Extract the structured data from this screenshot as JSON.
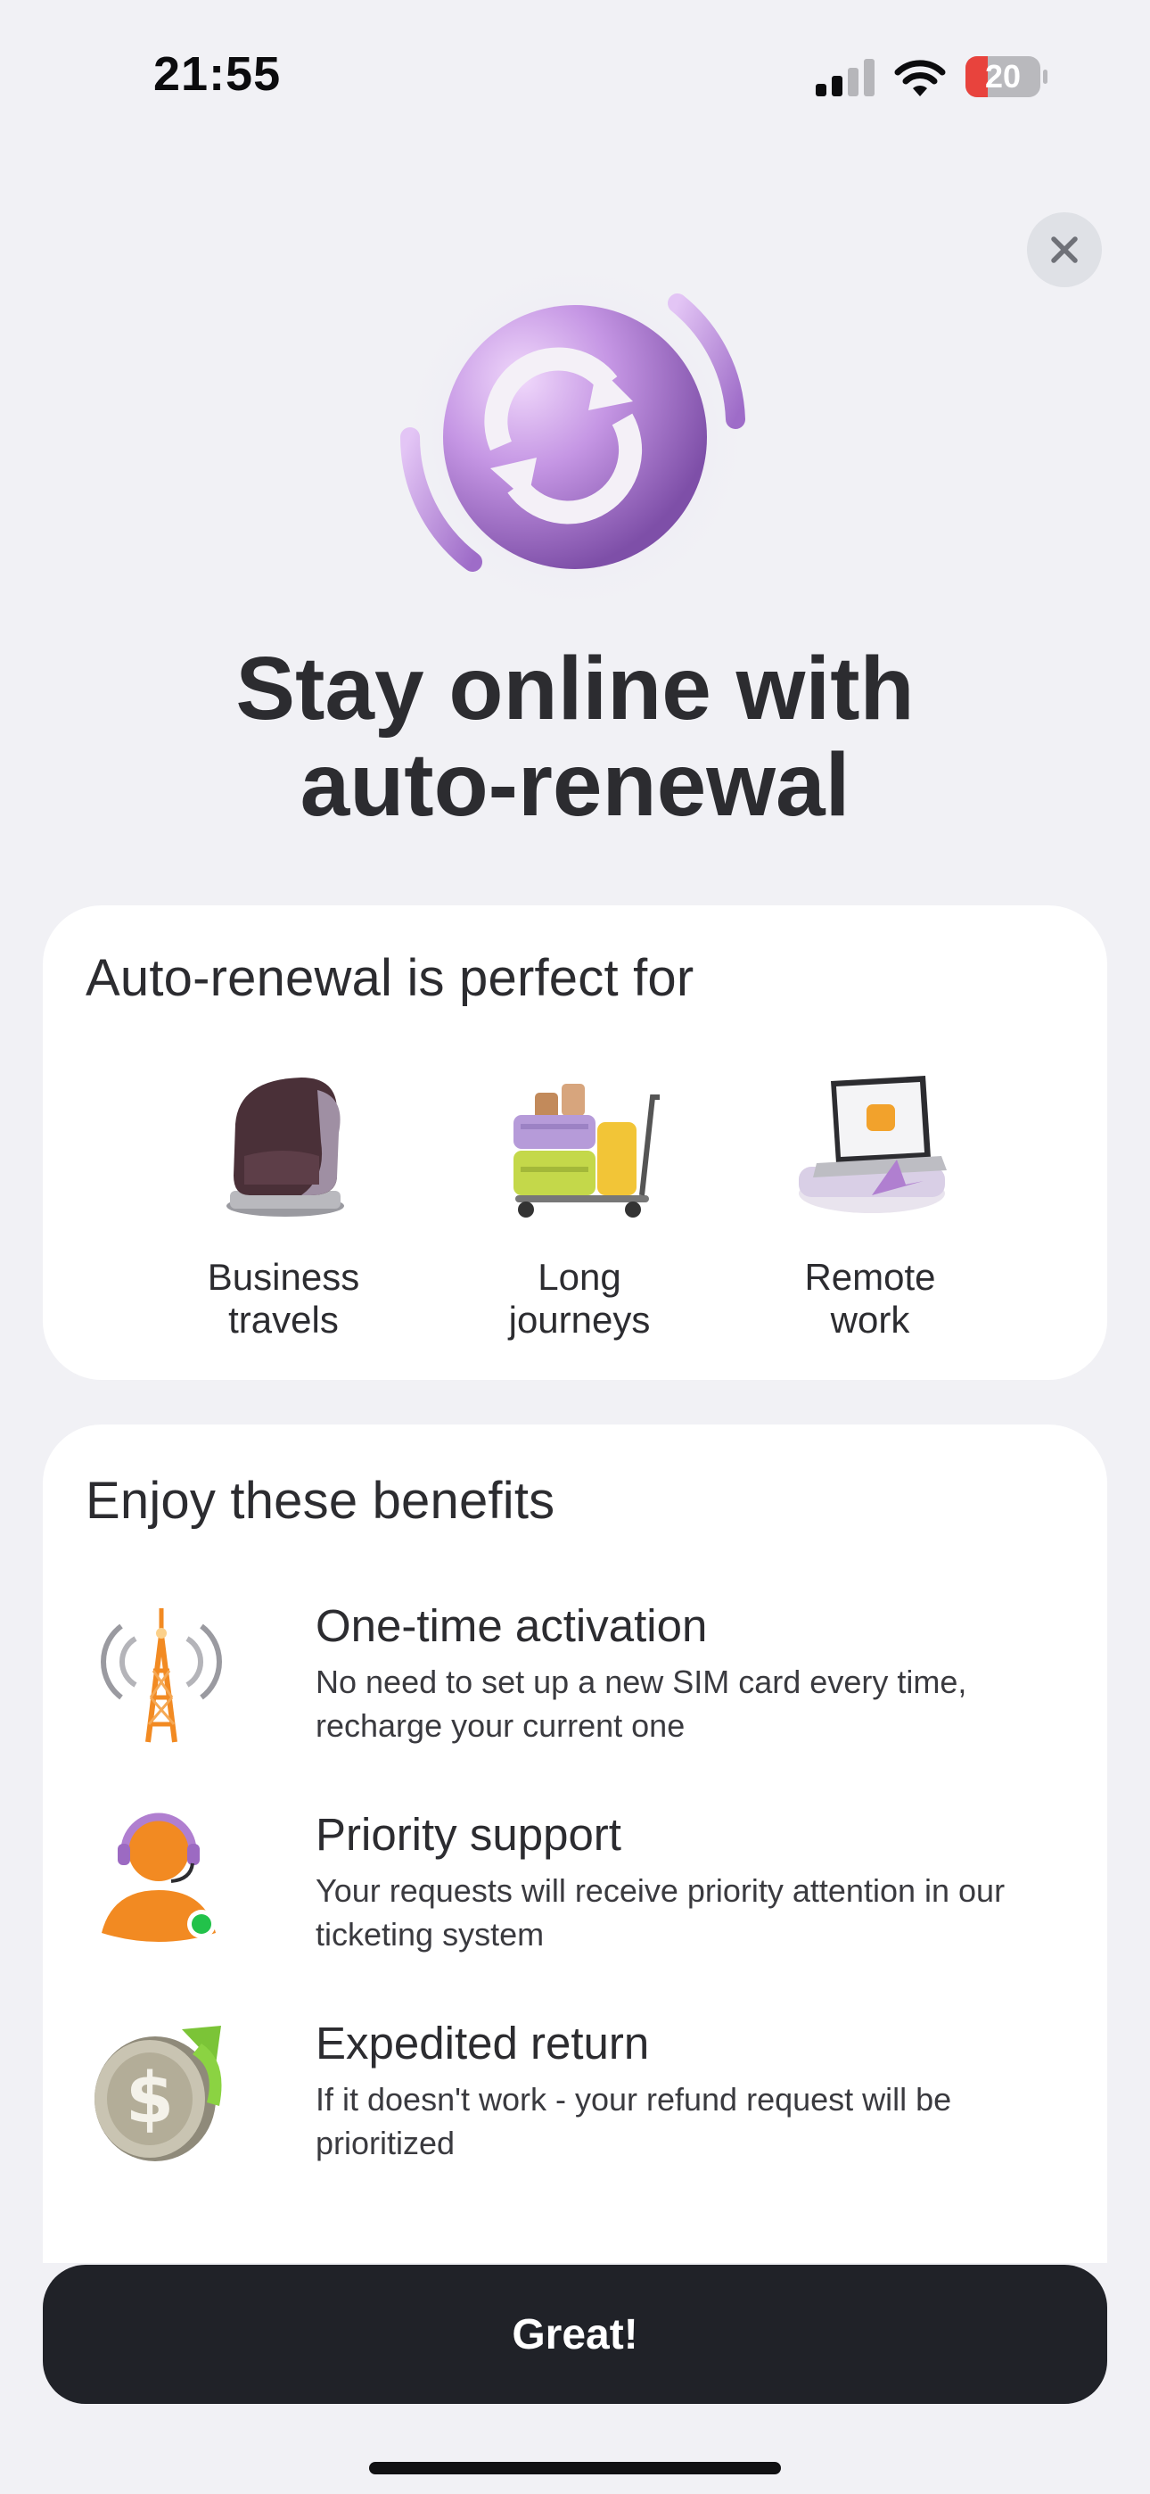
{
  "status_bar": {
    "time": "21:55",
    "battery_level": "20",
    "icons": [
      "cellular-signal-icon",
      "wifi-icon",
      "battery-icon"
    ]
  },
  "close_icon": "close-icon",
  "hero": {
    "icon": "auto-renewal-sync-icon",
    "title_line1": "Stay online with",
    "title_line2": "auto-renewal"
  },
  "use_cases": {
    "title": "Auto-renewal is perfect for",
    "items": [
      {
        "label": "Business\ntravels",
        "icon": "armchair-icon"
      },
      {
        "label": "Long\njourneys",
        "icon": "luggage-cart-icon"
      },
      {
        "label": "Remote\nwork",
        "icon": "laptop-icon"
      }
    ]
  },
  "benefits": {
    "title": "Enjoy these benefits",
    "items": [
      {
        "title": "One-time activation",
        "description": "No need to set up a new SIM card every time, recharge your current one",
        "icon": "cell-tower-icon"
      },
      {
        "title": "Priority support",
        "description": "Your requests will receive priority attention in our ticketing system",
        "icon": "support-agent-icon"
      },
      {
        "title": "Expedited return",
        "description": "If it doesn't work - your refund request will be prioritized",
        "icon": "dollar-coin-return-icon"
      }
    ]
  },
  "cta": {
    "label": "Great!"
  },
  "colors": {
    "background": "#f1f1f5",
    "card": "#ffffff",
    "text": "#2c2c30",
    "button": "#202228",
    "button_text": "#ffffff",
    "accent_purple": "#b58bd6",
    "accent_orange": "#f28a22",
    "battery_red": "#e8433d"
  }
}
